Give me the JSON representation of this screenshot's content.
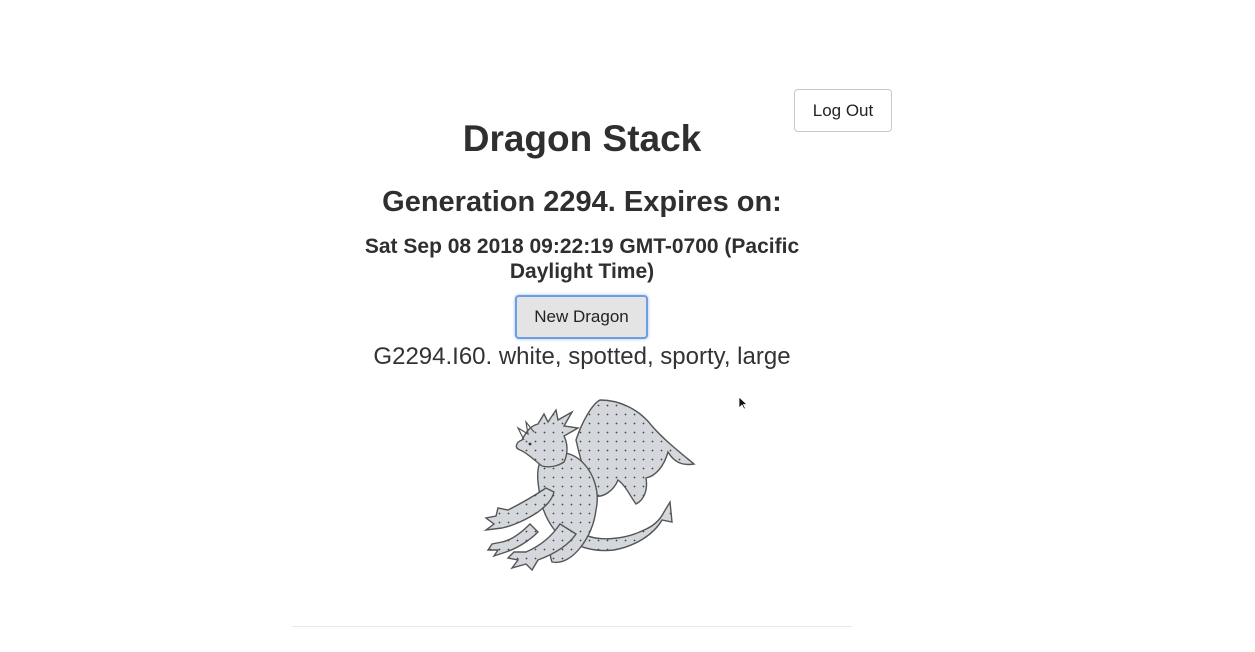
{
  "header": {
    "logout_label": "Log Out",
    "title": "Dragon Stack"
  },
  "generation": {
    "heading": "Generation 2294. Expires on:",
    "expiration": "Sat Sep 08 2018 09:22:19 GMT-0700 (Pacific Daylight Time)"
  },
  "dragon": {
    "new_dragon_label": "New Dragon",
    "description": "G2294.I60. white, spotted, sporty, large",
    "image_icon": "spotted-dragon-icon"
  },
  "colors": {
    "dragon_fill": "#d4d8dd",
    "dragon_stroke": "#555555",
    "button_focus": "#6d9fe0"
  }
}
